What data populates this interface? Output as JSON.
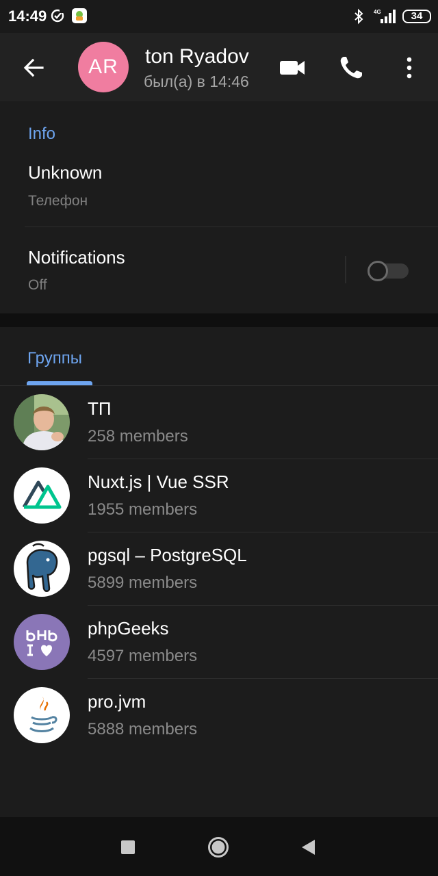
{
  "status_bar": {
    "time": "14:49",
    "network": "4G",
    "battery": "34",
    "icons": [
      "sync-icon",
      "app-icon",
      "bluetooth-icon",
      "signal-icon",
      "battery-icon"
    ]
  },
  "header": {
    "avatar_initials": "AR",
    "avatar_color": "#f07da0",
    "name": "ton Ryadov",
    "last_seen": "был(а) в 14:46",
    "icons": [
      "arrow-left-icon",
      "video-camera-icon",
      "phone-icon",
      "more-vertical-icon"
    ]
  },
  "info": {
    "header": "Info",
    "phone_value": "Unknown",
    "phone_label": "Телефон",
    "notifications_title": "Notifications",
    "notifications_value": "Off",
    "notifications_enabled": false
  },
  "groups": {
    "tab_label": "Группы",
    "items": [
      {
        "name": "ТП",
        "members": "258 members",
        "avatar": "photo-avatar"
      },
      {
        "name": "Nuxt.js | Vue SSR",
        "members": "1955 members",
        "avatar": "nuxt-logo-icon"
      },
      {
        "name": "pgsql – PostgreSQL",
        "members": "5899 members",
        "avatar": "postgresql-elephant-icon"
      },
      {
        "name": "phpGeeks",
        "members": "4597 members",
        "avatar": "phpgeeks-logo-icon"
      },
      {
        "name": "pro.jvm",
        "members": "5888 members",
        "avatar": "java-cup-icon"
      }
    ]
  },
  "colors": {
    "accent": "#6ea5f0",
    "background": "#1c1c1c",
    "app_bar": "#222222"
  },
  "nav_bar": {
    "icons": [
      "recents-square-icon",
      "home-circle-icon",
      "back-triangle-icon"
    ]
  }
}
